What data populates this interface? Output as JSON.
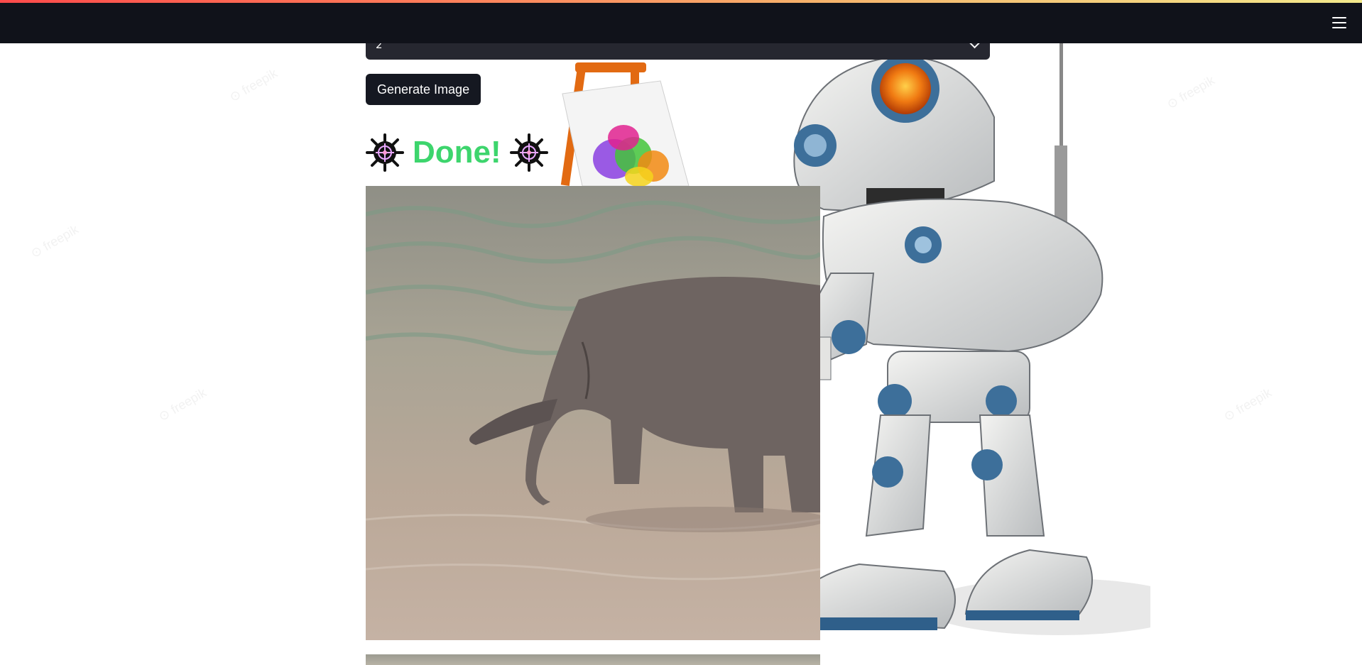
{
  "header": {
    "menu_icon": "hamburger-menu-icon"
  },
  "select": {
    "value": "2",
    "icon": "chevron-down-icon"
  },
  "actions": {
    "generate_label": "Generate Image"
  },
  "status": {
    "done_text": "Done!",
    "icon": "sparkle-icon"
  },
  "colors": {
    "header_bg": "#10121a",
    "button_bg": "#151821",
    "select_bg": "#262730",
    "done_green": "#3dd56d",
    "accent_gradient": [
      "#ff4b4b",
      "#f6b26b",
      "#f3e98c"
    ]
  },
  "images": {
    "result_1": "elephant-in-water-image",
    "background": "robot-painting-illustration"
  }
}
